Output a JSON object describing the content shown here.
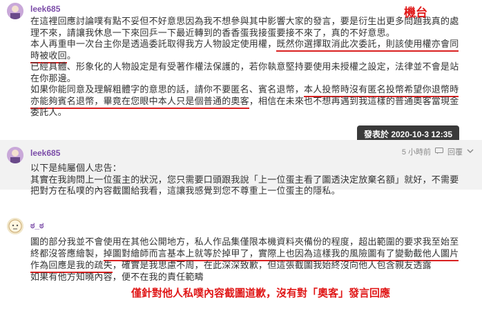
{
  "posts": [
    {
      "username": "leek685",
      "paragraphs": [
        [
          "在這裡回應討論噗有點不妥但不好意思因為我不想參與其中影響大家的發言，要是衍生出更多問題我真的處理不來，請讓我休息一下來回乒一下最近轉到的香香蛋我接蛋要接不來了，真的不好意思。"
        ],
        [
          "本人再重申一次台主你是透過委託取得我方人物設定使用權，",
          "既然你選擇取消此次委託，則該使用權亦會同時被收回",
          "。"
        ],
        [
          "已經具體、形象化的人物設定是有受著作權法保護的，若你執意堅持要使用未授權之設定，法律並不會是站在你那邊。"
        ],
        [
          "如果你能同意及理解粗體字的意思的話，請你不要匿名、賓名退幣，",
          "本人投幣時沒有匿名投幣希望你退幣時亦能夠賓名退幣，畢竟在您眼中本人只是個普通的奧客",
          "，相信在未來也不想再遇到我這樣的普通奧客當現金委託人。"
        ]
      ],
      "timestamp_tip": "發表於 2020-10-3 12:35"
    },
    {
      "username": "leek685",
      "lines": [
        "以下是純屬個人忠告：",
        "其實在我詢問上一位蛋主的狀況，您只需要口頭跟我說「上一位蛋主看了圖透決定放棄名額」就好，不需要把對方在私噗的內容截圖給我看，這讓我感覺到您不尊重上一位蛋主的隱私。"
      ],
      "meta": {
        "time": "5 小時前",
        "reply": "回覆"
      }
    },
    {
      "username": "ಠ_ಠ",
      "paragraphs": [
        [
          "圖的部分我並不會使用在其他公開地方，私人作品集僅限本機資料夾備份的程度，超出範圍的要求我至始至終都沒答應繪製，",
          "掉圖對繪師而言基本上就等於掉甲了，實際上也因為這樣我的風險圖有了變動截他人圖片作為回應是我的疏失",
          "，確實是我思慮不周，在此深深致歉，但這張截圖我始終沒向他人包含親友透露"
        ],
        [
          "如果有他方知曉內容，便不在我的責任範疇"
        ]
      ]
    }
  ],
  "annotations": {
    "machine": "機台",
    "apology": "僅針對他人私噗內容截圖道歉，沒有對「奧客」發言回應"
  },
  "colors": {
    "username": "#7b4ca8",
    "annotation": "#e01818",
    "underline": "#d92020"
  }
}
